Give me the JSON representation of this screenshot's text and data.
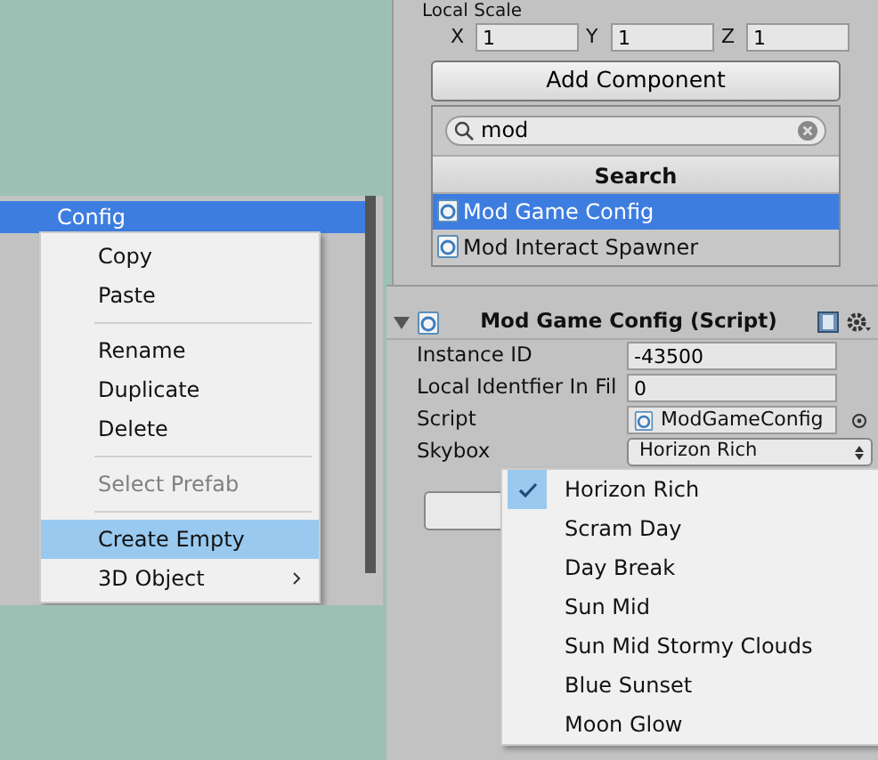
{
  "transform": {
    "label": "Local Scale",
    "fields": [
      {
        "axis": "X",
        "value": "1"
      },
      {
        "axis": "Y",
        "value": "1"
      },
      {
        "axis": "Z",
        "value": "1"
      }
    ]
  },
  "add_component": {
    "button": "Add Component",
    "search": {
      "value": "mod"
    },
    "header": "Search",
    "results": [
      {
        "label": "Mod Game Config",
        "selected": true
      },
      {
        "label": "Mod Interact Spawner",
        "selected": false
      }
    ]
  },
  "hierarchy": {
    "items": [
      {
        "label": "Config",
        "selected": true
      }
    ]
  },
  "context_menu": {
    "items": [
      {
        "kind": "item",
        "label": "Copy",
        "disabled": false,
        "highlighted": false
      },
      {
        "kind": "item",
        "label": "Paste",
        "disabled": false,
        "highlighted": false
      },
      {
        "kind": "separator"
      },
      {
        "kind": "item",
        "label": "Rename",
        "disabled": false,
        "highlighted": false
      },
      {
        "kind": "item",
        "label": "Duplicate",
        "disabled": false,
        "highlighted": false
      },
      {
        "kind": "item",
        "label": "Delete",
        "disabled": false,
        "highlighted": false
      },
      {
        "kind": "separator"
      },
      {
        "kind": "item",
        "label": "Select Prefab",
        "disabled": true,
        "highlighted": false
      },
      {
        "kind": "separator"
      },
      {
        "kind": "item",
        "label": "Create Empty",
        "disabled": false,
        "highlighted": true
      },
      {
        "kind": "submenu",
        "label": "3D Object",
        "disabled": false,
        "highlighted": false
      }
    ]
  },
  "component": {
    "title": "Mod Game Config (Script)",
    "expanded": true,
    "fields": [
      {
        "kind": "text",
        "label": "Instance ID",
        "value": "-43500"
      },
      {
        "kind": "text",
        "label": "Local Identfier In Fil",
        "value": "0"
      },
      {
        "kind": "object",
        "label": "Script",
        "value": "ModGameConfig"
      },
      {
        "kind": "dropdown",
        "label": "Skybox",
        "value": "Horizon Rich"
      }
    ]
  },
  "skybox_options": [
    {
      "label": "Horizon Rich",
      "selected": true
    },
    {
      "label": "Scram Day",
      "selected": false
    },
    {
      "label": "Day Break",
      "selected": false
    },
    {
      "label": "Sun Mid",
      "selected": false
    },
    {
      "label": "Sun Mid Stormy Clouds",
      "selected": false
    },
    {
      "label": "Blue Sunset",
      "selected": false
    },
    {
      "label": "Moon Glow",
      "selected": false
    }
  ]
}
